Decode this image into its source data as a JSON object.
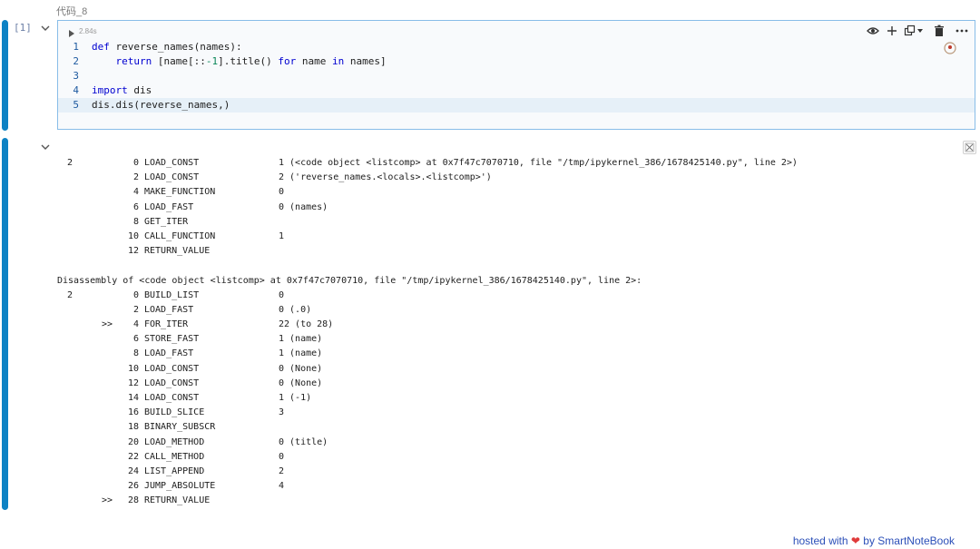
{
  "cell": {
    "title": "代码_8",
    "exec_count": "[1]",
    "exec_time": "2.84s"
  },
  "code_lines": [
    {
      "n": "1",
      "active": false,
      "tokens": [
        {
          "t": "def",
          "c": "kw"
        },
        {
          "t": " reverse_names(names):",
          "c": ""
        }
      ]
    },
    {
      "n": "2",
      "active": false,
      "tokens": [
        {
          "t": "    ",
          "c": ""
        },
        {
          "t": "return",
          "c": "kw"
        },
        {
          "t": " [name[::",
          "c": ""
        },
        {
          "t": "-1",
          "c": "num"
        },
        {
          "t": "].title() ",
          "c": ""
        },
        {
          "t": "for",
          "c": "kw"
        },
        {
          "t": " name ",
          "c": ""
        },
        {
          "t": "in",
          "c": "kw"
        },
        {
          "t": " names]",
          "c": ""
        }
      ]
    },
    {
      "n": "3",
      "active": false,
      "tokens": []
    },
    {
      "n": "4",
      "active": false,
      "tokens": [
        {
          "t": "import",
          "c": "kw"
        },
        {
          "t": " dis",
          "c": ""
        }
      ]
    },
    {
      "n": "5",
      "active": true,
      "tokens": [
        {
          "t": "dis.dis(reverse_names,)",
          "c": ""
        }
      ]
    }
  ],
  "output_lines": [
    {
      "ln": "2",
      "jmp": "",
      "off": "0",
      "op": "LOAD_CONST",
      "arg": "1 (<code object <listcomp> at 0x7f47c7070710, file \"/tmp/ipykernel_386/1678425140.py\", line 2>)"
    },
    {
      "ln": "",
      "jmp": "",
      "off": "2",
      "op": "LOAD_CONST",
      "arg": "2 ('reverse_names.<locals>.<listcomp>')"
    },
    {
      "ln": "",
      "jmp": "",
      "off": "4",
      "op": "MAKE_FUNCTION",
      "arg": "0"
    },
    {
      "ln": "",
      "jmp": "",
      "off": "6",
      "op": "LOAD_FAST",
      "arg": "0 (names)"
    },
    {
      "ln": "",
      "jmp": "",
      "off": "8",
      "op": "GET_ITER",
      "arg": ""
    },
    {
      "ln": "",
      "jmp": "",
      "off": "10",
      "op": "CALL_FUNCTION",
      "arg": "1"
    },
    {
      "ln": "",
      "jmp": "",
      "off": "12",
      "op": "RETURN_VALUE",
      "arg": ""
    },
    {
      "full": ""
    },
    {
      "full": "Disassembly of <code object <listcomp> at 0x7f47c7070710, file \"/tmp/ipykernel_386/1678425140.py\", line 2>:"
    },
    {
      "ln": "2",
      "jmp": "",
      "off": "0",
      "op": "BUILD_LIST",
      "arg": "0"
    },
    {
      "ln": "",
      "jmp": "",
      "off": "2",
      "op": "LOAD_FAST",
      "arg": "0 (.0)"
    },
    {
      "ln": "",
      "jmp": ">>",
      "off": "4",
      "op": "FOR_ITER",
      "arg": "22 (to 28)"
    },
    {
      "ln": "",
      "jmp": "",
      "off": "6",
      "op": "STORE_FAST",
      "arg": "1 (name)"
    },
    {
      "ln": "",
      "jmp": "",
      "off": "8",
      "op": "LOAD_FAST",
      "arg": "1 (name)"
    },
    {
      "ln": "",
      "jmp": "",
      "off": "10",
      "op": "LOAD_CONST",
      "arg": "0 (None)"
    },
    {
      "ln": "",
      "jmp": "",
      "off": "12",
      "op": "LOAD_CONST",
      "arg": "0 (None)"
    },
    {
      "ln": "",
      "jmp": "",
      "off": "14",
      "op": "LOAD_CONST",
      "arg": "1 (-1)"
    },
    {
      "ln": "",
      "jmp": "",
      "off": "16",
      "op": "BUILD_SLICE",
      "arg": "3"
    },
    {
      "ln": "",
      "jmp": "",
      "off": "18",
      "op": "BINARY_SUBSCR",
      "arg": ""
    },
    {
      "ln": "",
      "jmp": "",
      "off": "20",
      "op": "LOAD_METHOD",
      "arg": "0 (title)"
    },
    {
      "ln": "",
      "jmp": "",
      "off": "22",
      "op": "CALL_METHOD",
      "arg": "0"
    },
    {
      "ln": "",
      "jmp": "",
      "off": "24",
      "op": "LIST_APPEND",
      "arg": "2"
    },
    {
      "ln": "",
      "jmp": "",
      "off": "26",
      "op": "JUMP_ABSOLUTE",
      "arg": "4"
    },
    {
      "ln": "",
      "jmp": ">>",
      "off": "28",
      "op": "RETURN_VALUE",
      "arg": ""
    }
  ],
  "footer": {
    "prefix": "hosted with",
    "heart": "❤",
    "suffix": "by SmartNoteBook"
  },
  "icons": {
    "run": "play-icon",
    "toolbar": [
      "eye-icon",
      "plus-icon",
      "copy-dropdown-icon",
      "trash-icon",
      "more-icon"
    ],
    "timer": "timer-icon",
    "output": "clear-output-icon"
  },
  "colors": {
    "accent_bar": "#0d82c4",
    "editor_border": "#88bde8",
    "keyword": "#0000d0",
    "footer_link": "#2b4fb8",
    "heart": "#e03b3b"
  }
}
